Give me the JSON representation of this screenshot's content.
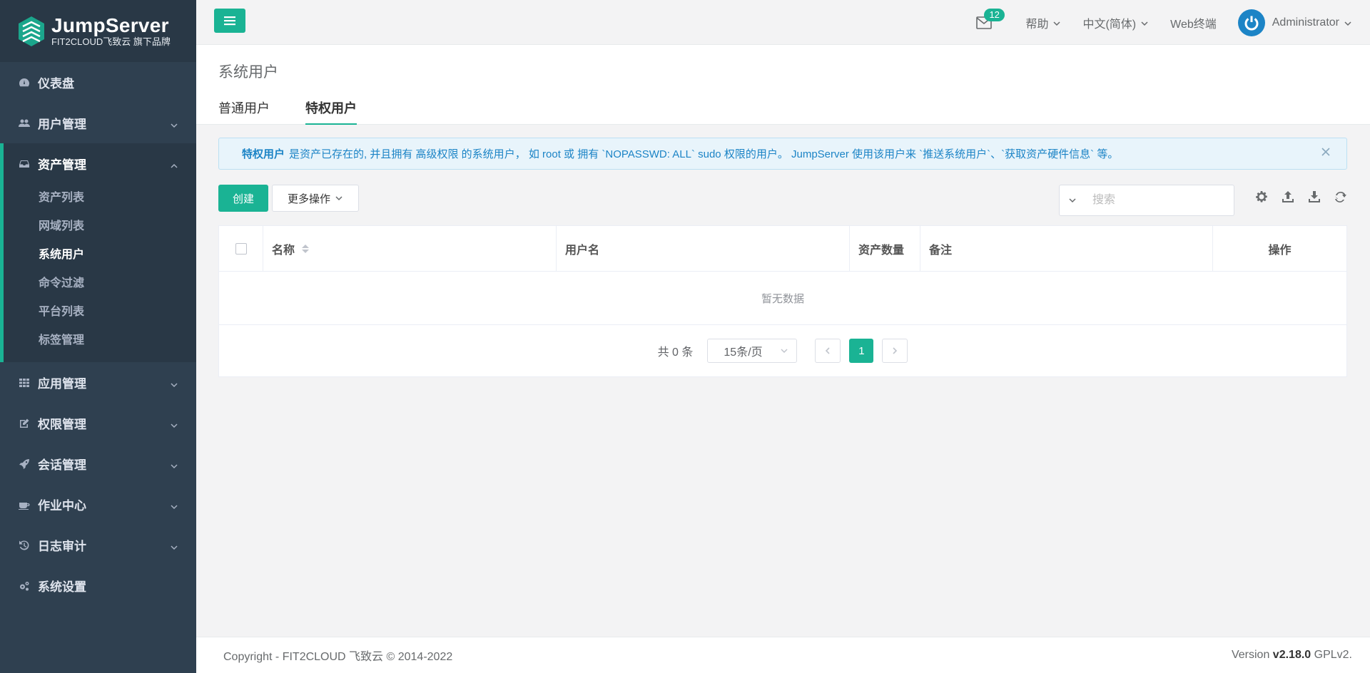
{
  "brand": {
    "name": "JumpServer",
    "subtitle": "FIT2CLOUD飞致云 旗下品牌"
  },
  "sidebar": {
    "items": [
      {
        "label": "仪表盘",
        "icon": "dashboard-icon"
      },
      {
        "label": "用户管理",
        "icon": "users-icon"
      },
      {
        "label": "资产管理",
        "icon": "inbox-icon"
      },
      {
        "label": "应用管理",
        "icon": "grid-icon"
      },
      {
        "label": "权限管理",
        "icon": "edit-icon"
      },
      {
        "label": "会话管理",
        "icon": "rocket-icon"
      },
      {
        "label": "作业中心",
        "icon": "coffee-icon"
      },
      {
        "label": "日志审计",
        "icon": "history-icon"
      },
      {
        "label": "系统设置",
        "icon": "gears-icon"
      }
    ],
    "asset_subitems": [
      "资产列表",
      "网域列表",
      "系统用户",
      "命令过滤",
      "平台列表",
      "标签管理"
    ]
  },
  "topbar": {
    "mail_count": "12",
    "help": "帮助",
    "language": "中文(简体)",
    "web_terminal": "Web终端",
    "user": "Administrator"
  },
  "page": {
    "title": "系统用户",
    "tabs": [
      "普通用户",
      "特权用户"
    ],
    "active_tab": "特权用户"
  },
  "alert": {
    "bold": "特权用户",
    "text": "是资产已存在的, 并且拥有 高级权限 的系统用户， 如 root 或 拥有 `NOPASSWD: ALL` sudo 权限的用户。 JumpServer 使用该用户来 `推送系统用户`、`获取资产硬件信息` 等。"
  },
  "toolbar": {
    "create": "创建",
    "more": "更多操作",
    "search_placeholder": "搜索"
  },
  "table": {
    "columns": [
      "名称",
      "用户名",
      "资产数量",
      "备注",
      "操作"
    ],
    "empty": "暂无数据"
  },
  "pager": {
    "total": "共 0 条",
    "page_size": "15条/页",
    "current": "1"
  },
  "footer": {
    "copyright": "Copyright - FIT2CLOUD 飞致云 © 2014-2022",
    "version_prefix": "Version",
    "version": "v2.18.0",
    "license": "GPLv2."
  },
  "colors": {
    "accent": "#1ab394",
    "sidebar": "#2f4050",
    "info": "#1c84c6"
  }
}
